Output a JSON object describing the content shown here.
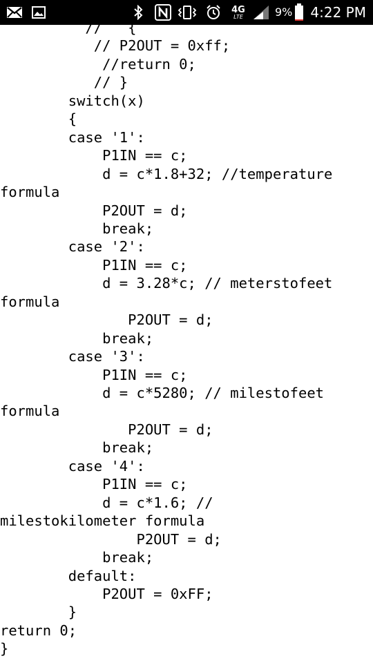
{
  "status_bar": {
    "icons": [
      "mail-icon",
      "image-icon",
      "bluetooth-icon",
      "nfc-icon",
      "vibrate-icon",
      "alarm-icon",
      "4g-lte-icon",
      "signal-icon",
      "battery-icon"
    ],
    "network_label": "4G",
    "network_sublabel": "LTE",
    "battery_percent": "9%",
    "time": "4:22 PM",
    "battery_level": 0.09,
    "battery_color": "#e53935"
  },
  "code_lines": [
    "          //   {",
    "           // P2OUT = 0xff;",
    "            //return 0;",
    "           // }",
    "        switch(x)",
    "        {",
    "        case '1':",
    "            P1IN == c;",
    "            d = c*1.8+32; //temperature",
    "formula",
    "            P2OUT = d;",
    "            break;",
    "        case '2':",
    "            P1IN == c;",
    "            d = 3.28*c; // meterstofeet",
    "formula",
    "               P2OUT = d;",
    "            break;",
    "        case '3':",
    "            P1IN == c;",
    "            d = c*5280; // milestofeet",
    "formula",
    "               P2OUT = d;",
    "            break;",
    "        case '4':",
    "            P1IN == c;",
    "            d = c*1.6; //",
    "milestokilometer formula",
    "                P2OUT = d;",
    "            break;",
    "        default:",
    "            P2OUT = 0xFF;",
    "        }",
    "return 0;",
    "}"
  ]
}
